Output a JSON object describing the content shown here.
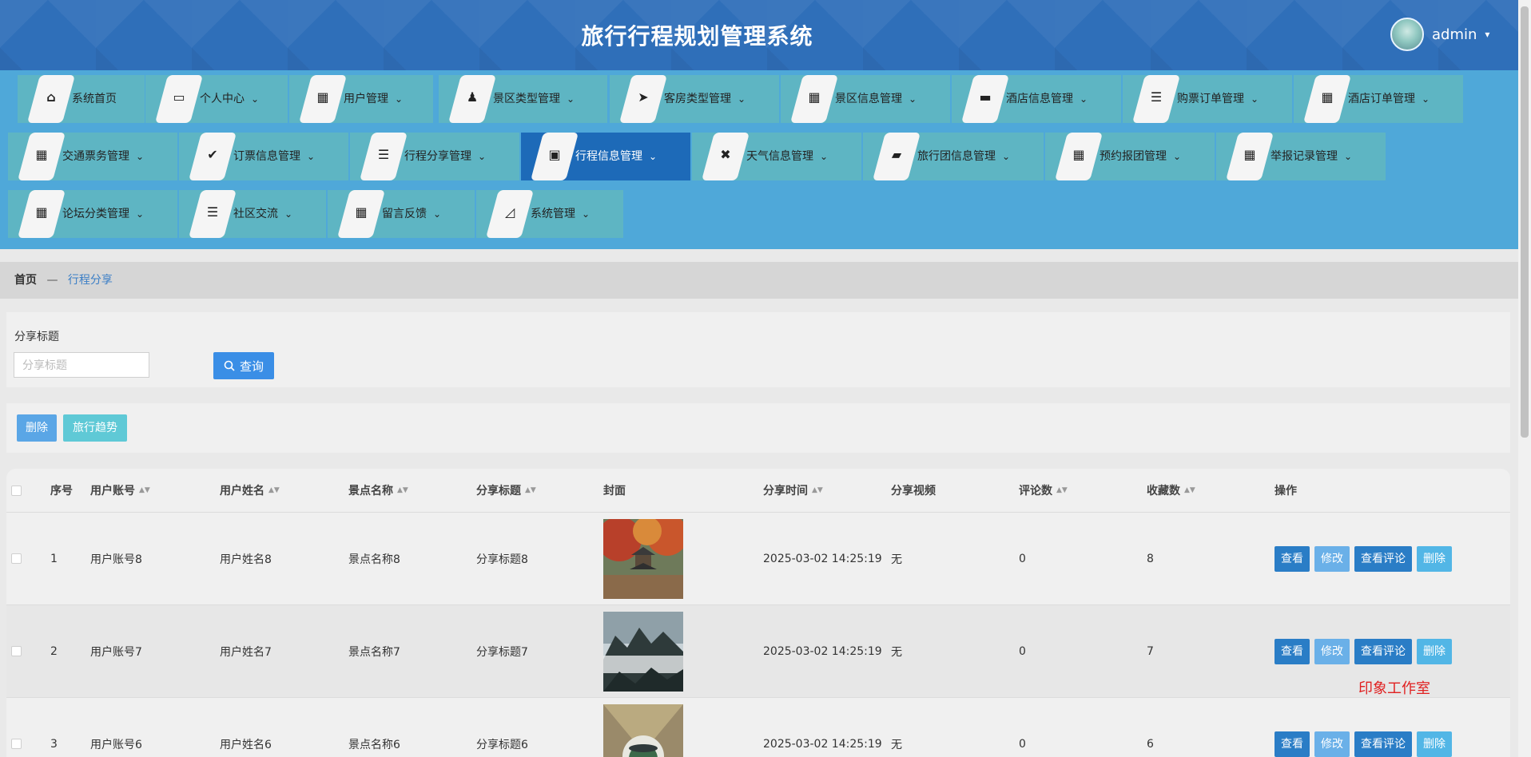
{
  "header": {
    "title": "旅行行程规划管理系统",
    "username": "admin",
    "caret": "▾"
  },
  "nav": {
    "caret": "⌄",
    "items": [
      {
        "label": "系统首页",
        "icon": "⌂",
        "icon_name": "home-icon"
      },
      {
        "label": "个人中心",
        "icon": "▭",
        "icon_name": "wallet-icon"
      },
      {
        "label": "用户管理",
        "icon": "▦",
        "icon_name": "grid-icon"
      },
      {
        "label": "景区类型管理",
        "icon": "♟",
        "icon_name": "stamp-icon"
      },
      {
        "label": "客房类型管理",
        "icon": "➤",
        "icon_name": "paper-plane-icon"
      },
      {
        "label": "景区信息管理",
        "icon": "▦",
        "icon_name": "grid-icon"
      },
      {
        "label": "酒店信息管理",
        "icon": "▬",
        "icon_name": "chat-icon"
      },
      {
        "label": "购票订单管理",
        "icon": "☰",
        "icon_name": "sliders-icon"
      },
      {
        "label": "酒店订单管理",
        "icon": "▦",
        "icon_name": "grid-icon"
      },
      {
        "label": "交通票务管理",
        "icon": "▦",
        "icon_name": "grid-icon"
      },
      {
        "label": "订票信息管理",
        "icon": "✔",
        "icon_name": "clipboard-check-icon"
      },
      {
        "label": "行程分享管理",
        "icon": "☰",
        "icon_name": "list-icon"
      },
      {
        "label": "行程信息管理",
        "icon": "▣",
        "icon_name": "store-icon"
      },
      {
        "label": "天气信息管理",
        "icon": "✖",
        "icon_name": "ticket-icon"
      },
      {
        "label": "旅行团信息管理",
        "icon": "▰",
        "icon_name": "wallet-icon"
      },
      {
        "label": "预约报团管理",
        "icon": "▦",
        "icon_name": "grid-icon"
      },
      {
        "label": "举报记录管理",
        "icon": "▦",
        "icon_name": "grid-icon"
      },
      {
        "label": "论坛分类管理",
        "icon": "▦",
        "icon_name": "grid-icon"
      },
      {
        "label": "社区交流",
        "icon": "☰",
        "icon_name": "list-icon"
      },
      {
        "label": "留言反馈",
        "icon": "▦",
        "icon_name": "grid-icon"
      },
      {
        "label": "系统管理",
        "icon": "◿",
        "icon_name": "chart-icon"
      }
    ]
  },
  "breadcrumb": {
    "home": "首页",
    "separator": "—",
    "current": "行程分享"
  },
  "search": {
    "label": "分享标题",
    "placeholder": "分享标题",
    "button": "查询",
    "icon_name": "search-icon"
  },
  "actions": {
    "delete": "删除",
    "trend": "旅行趋势"
  },
  "table": {
    "headers": {
      "index": "序号",
      "account": "用户账号",
      "name": "用户姓名",
      "spot": "景点名称",
      "title": "分享标题",
      "cover": "封面",
      "time": "分享时间",
      "video": "分享视频",
      "comments": "评论数",
      "favorites": "收藏数",
      "ops": "操作"
    },
    "rows": [
      {
        "index": "1",
        "account": "用户账号8",
        "name": "用户姓名8",
        "spot": "景点名称8",
        "title": "分享标题8",
        "time": "2025-03-02 14:25:19",
        "video": "无",
        "comments": "0",
        "favorites": "8"
      },
      {
        "index": "2",
        "account": "用户账号7",
        "name": "用户姓名7",
        "spot": "景点名称7",
        "title": "分享标题7",
        "time": "2025-03-02 14:25:19",
        "video": "无",
        "comments": "0",
        "favorites": "7"
      },
      {
        "index": "3",
        "account": "用户账号6",
        "name": "用户姓名6",
        "spot": "景点名称6",
        "title": "分享标题6",
        "time": "2025-03-02 14:25:19",
        "video": "无",
        "comments": "0",
        "favorites": "6"
      }
    ],
    "ops": {
      "view": "查看",
      "edit": "修改",
      "view_comments": "查看评论",
      "delete": "删除"
    }
  },
  "watermark": "印象工作室",
  "colors": {
    "header": "#2f6fb9",
    "nav_bg": "#4fa8d9",
    "nav_item": "#5eb5c3",
    "nav_active": "#1d6ab8",
    "primary": "#2a7dc6",
    "light_btn": "#6ab0e8",
    "delete_btn": "#52b6e6",
    "trend_btn": "#5fc9d6",
    "watermark": "#e02020"
  }
}
